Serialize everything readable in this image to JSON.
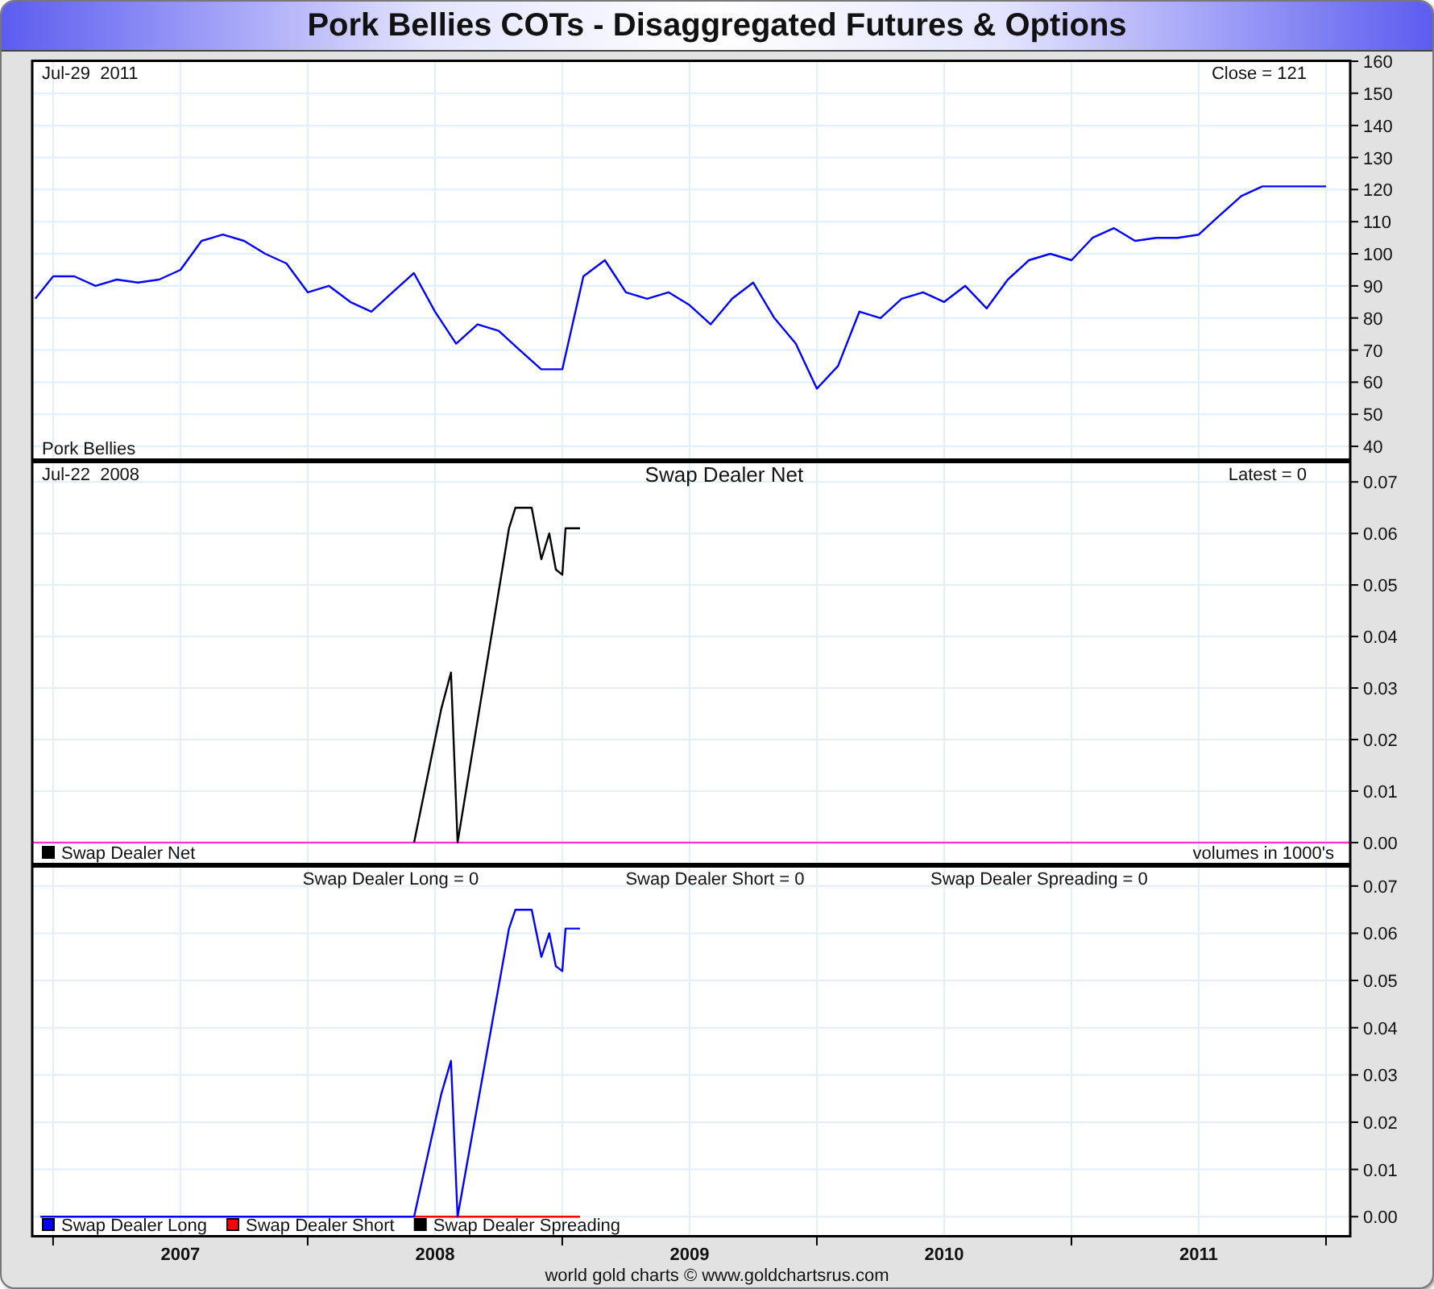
{
  "title": "Pork Bellies COTs - Disaggregated Futures & Options",
  "panels": [
    {
      "date": "Jul-29  2011",
      "reading": "Close = 121",
      "legend_swatches": false,
      "chart_data": {
        "type": "line",
        "grid": true,
        "legend": true,
        "x": [
          2006.93,
          2007.0,
          2007.083,
          2007.167,
          2007.25,
          2007.333,
          2007.417,
          2007.5,
          2007.583,
          2007.667,
          2007.75,
          2007.833,
          2007.917,
          2008.0,
          2008.083,
          2008.167,
          2008.25,
          2008.333,
          2008.417,
          2008.5,
          2008.583,
          2008.667,
          2008.75,
          2008.833,
          2008.917,
          2009.0,
          2009.083,
          2009.167,
          2009.25,
          2009.333,
          2009.417,
          2009.5,
          2009.583,
          2009.667,
          2009.75,
          2009.833,
          2009.917,
          2010.0,
          2010.083,
          2010.167,
          2010.25,
          2010.333,
          2010.417,
          2010.5,
          2010.583,
          2010.667,
          2010.75,
          2010.833,
          2010.917,
          2011.0,
          2011.083,
          2011.167,
          2011.25,
          2011.333,
          2011.417,
          2011.5,
          2011.583,
          2011.667,
          2011.75,
          2011.833,
          2011.917,
          2012.0
        ],
        "series": [
          {
            "name": "Pork Bellies",
            "color": "#0000ff",
            "values": [
              86,
              93,
              93,
              90,
              92,
              91,
              92,
              95,
              104,
              106,
              104,
              100,
              97,
              88,
              90,
              85,
              82,
              88,
              94,
              82,
              72,
              78,
              76,
              70,
              64,
              64,
              93,
              98,
              88,
              86,
              88,
              84,
              78,
              86,
              91,
              80,
              72,
              58,
              65,
              82,
              80,
              86,
              88,
              85,
              90,
              83,
              92,
              98,
              100,
              98,
              105,
              108,
              104,
              105,
              105,
              106,
              112,
              118,
              121,
              121,
              121,
              121
            ]
          }
        ],
        "xlim": [
          2006.918,
          2012.095
        ],
        "ylim": [
          35.5,
          160.5
        ],
        "yticks": [
          40,
          50,
          60,
          70,
          80,
          90,
          100,
          110,
          120,
          130,
          140,
          150,
          160
        ]
      }
    },
    {
      "date": "Jul-22  2008",
      "reading": "Latest = 0",
      "note": "volumes in 1000's",
      "legend_swatches": true,
      "chart_data": {
        "type": "line",
        "grid": true,
        "legend": true,
        "ref_lines": [
          {
            "axis": "y",
            "value": 0,
            "color": "#ff33cc"
          }
        ],
        "title": "Swap Dealer Net",
        "x": [
          2008.418,
          2008.525,
          2008.563,
          2008.589,
          2008.791,
          2008.816,
          2008.88,
          2008.918,
          2008.949,
          2008.975,
          2009.0,
          2009.013,
          2009.07
        ],
        "series": [
          {
            "name": "Swap Dealer Net",
            "color": "#000000",
            "values": [
              0,
              0.026,
              0.033,
              0,
              0.061,
              0.065,
              0.065,
              0.055,
              0.06,
              0.053,
              0.052,
              0.061,
              0.061
            ]
          }
        ],
        "xlim": [
          2006.918,
          2012.095
        ],
        "ylim": [
          -0.0044,
          0.0741
        ],
        "yticks": [
          {
            "value": 0,
            "label": "0.00"
          },
          {
            "value": 0.01,
            "label": "0.01"
          },
          {
            "value": 0.02,
            "label": "0.02"
          },
          {
            "value": 0.03,
            "label": "0.03"
          },
          {
            "value": 0.04,
            "label": "0.04"
          },
          {
            "value": 0.05,
            "label": "0.05"
          },
          {
            "value": 0.06,
            "label": "0.06"
          },
          {
            "value": 0.07,
            "label": "0.07"
          }
        ]
      }
    },
    {
      "readings": [
        "Swap Dealer Long = 0",
        "Swap Dealer Short = 0",
        "Swap Dealer Spreading = 0"
      ],
      "legend_swatches": true,
      "chart_data": {
        "type": "line",
        "grid": true,
        "legend": true,
        "x": [
          2006.95,
          2008.418,
          2008.525,
          2008.563,
          2008.589,
          2008.791,
          2008.816,
          2008.88,
          2008.918,
          2008.949,
          2008.975,
          2009.0,
          2009.013,
          2009.07
        ],
        "series": [
          {
            "name": "Swap Dealer Long",
            "color": "#0000ff",
            "values": [
              0,
              0,
              0.026,
              0.033,
              0,
              0.061,
              0.065,
              0.065,
              0.055,
              0.06,
              0.053,
              0.052,
              0.061,
              0.061
            ]
          },
          {
            "name": "Swap Dealer Short",
            "color": "#ff0000",
            "values": [
              null,
              0,
              0,
              0,
              0,
              0,
              0,
              0,
              0,
              0,
              0,
              0,
              0,
              0
            ]
          },
          {
            "name": "Swap Dealer Spreading",
            "color": "#000000",
            "values": [
              null,
              null,
              null,
              null,
              null,
              null,
              null,
              null,
              null,
              null,
              null,
              null,
              null,
              null
            ]
          }
        ],
        "xlim": [
          2006.918,
          2012.095
        ],
        "ylim": [
          -0.0044,
          0.0744
        ],
        "xticks": [
          {
            "value": 2007.5,
            "label": "2007"
          },
          {
            "value": 2008.5,
            "label": "2008"
          },
          {
            "value": 2009.5,
            "label": "2009"
          },
          {
            "value": 2010.5,
            "label": "2010"
          },
          {
            "value": 2011.5,
            "label": "2011"
          }
        ],
        "yticks": [
          {
            "value": 0,
            "label": "0.00"
          },
          {
            "value": 0.01,
            "label": "0.01"
          },
          {
            "value": 0.02,
            "label": "0.02"
          },
          {
            "value": 0.03,
            "label": "0.03"
          },
          {
            "value": 0.04,
            "label": "0.04"
          },
          {
            "value": 0.05,
            "label": "0.05"
          },
          {
            "value": 0.06,
            "label": "0.06"
          },
          {
            "value": 0.07,
            "label": "0.07"
          }
        ]
      }
    }
  ],
  "footer": "world gold charts © www.goldchartsrus.com"
}
